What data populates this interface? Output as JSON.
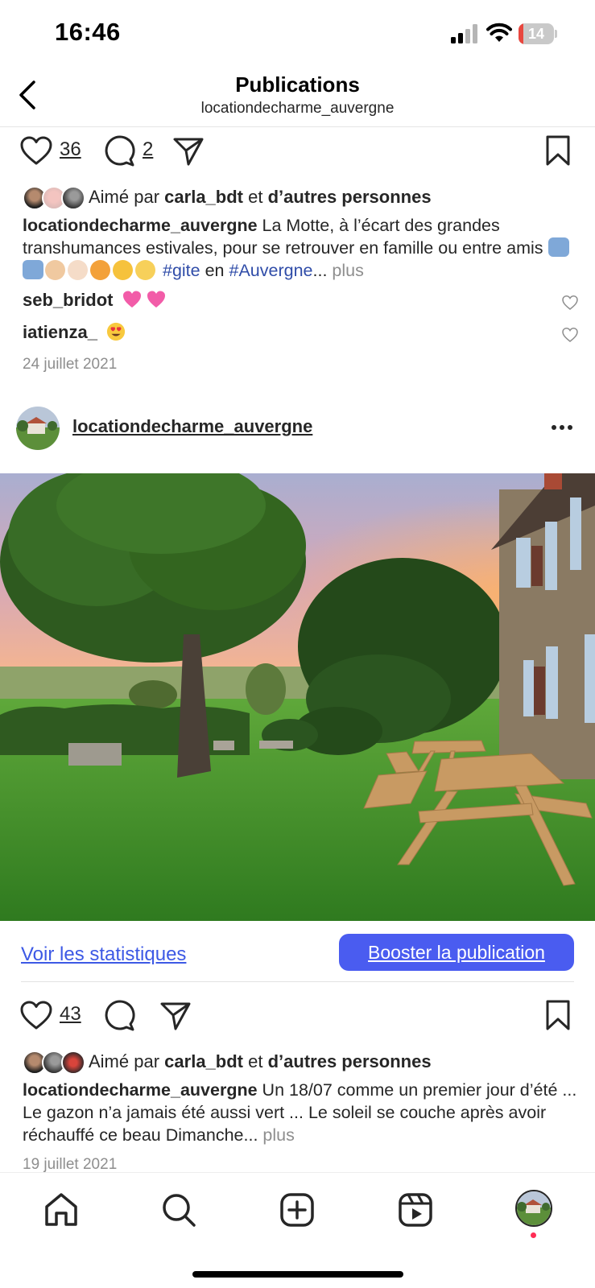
{
  "status_bar": {
    "time": "16:46",
    "battery": "14",
    "battery_level": 0.14
  },
  "header": {
    "title": "Publications",
    "subtitle": "locationdecharme_auvergne"
  },
  "post1": {
    "likes_count": "36",
    "comments_count": "2",
    "likes_prefix": "Aimé par",
    "liked_by": "carla_bdt",
    "likes_joiner": "et",
    "likes_others": "d’autres personnes",
    "caption_user": "locationdecharme_auvergne",
    "caption_text": "La Motte, à l’écart des grandes transhumances estivales, pour se retrouver en famille ou entre amis",
    "hashtag1": "#gite",
    "caption_join": "en",
    "hashtag2": "#Auvergne",
    "ellipsis": "...",
    "more": "plus",
    "comments": [
      {
        "user": "seb_bridot"
      },
      {
        "user": "iatienza_"
      }
    ],
    "date": "24 juillet 2021"
  },
  "post2": {
    "username": "locationdecharme_auvergne",
    "stats_link": "Voir les statistiques",
    "boost_button": "Booster la publication",
    "likes_count": "43",
    "likes_prefix": "Aimé par",
    "liked_by": "carla_bdt",
    "likes_joiner": "et",
    "likes_others": "d’autres personnes",
    "caption_user": "locationdecharme_auvergne",
    "caption_text": "Un 18/07 comme un premier jour d’été ... Le gazon n’a jamais été aussi vert ... Le soleil se couche après avoir réchauffé ce beau Dimanche",
    "ellipsis": "...",
    "more": "plus",
    "date": "19 juillet 2021"
  },
  "colors": {
    "link_blue": "#3d59e5",
    "boost_bg": "#4a5cf0",
    "hashtag": "#2f4ca8",
    "muted": "#8e8e8e"
  }
}
